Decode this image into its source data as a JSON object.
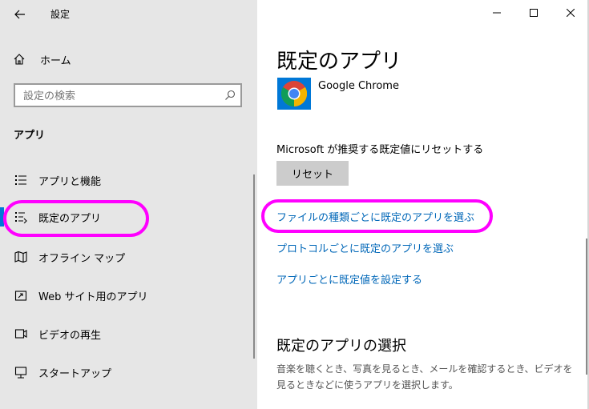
{
  "window": {
    "title": "設定",
    "controls": [
      "minimize",
      "maximize",
      "close"
    ]
  },
  "sidebar": {
    "home_label": "ホーム",
    "search": {
      "placeholder": "設定の検索"
    },
    "section_title": "アプリ",
    "items": [
      {
        "label": "アプリと機能",
        "icon": "list-icon",
        "selected": false
      },
      {
        "label": "既定のアプリ",
        "icon": "default-apps-icon",
        "selected": true
      },
      {
        "label": "オフライン マップ",
        "icon": "map-icon",
        "selected": false
      },
      {
        "label": "Web サイト用のアプリ",
        "icon": "open-window-icon",
        "selected": false
      },
      {
        "label": "ビデオの再生",
        "icon": "video-icon",
        "selected": false
      },
      {
        "label": "スタートアップ",
        "icon": "startup-icon",
        "selected": false
      }
    ]
  },
  "main": {
    "title": "既定のアプリ",
    "current_app": {
      "name": "Google Chrome",
      "icon": "chrome-icon"
    },
    "reset": {
      "description": "Microsoft が推奨する既定値にリセットする",
      "button_label": "リセット"
    },
    "links": [
      "ファイルの種類ごとに既定のアプリを選ぶ",
      "プロトコルごとに既定のアプリを選ぶ",
      "アプリごとに既定値を設定する"
    ],
    "section_title": "既定のアプリの選択",
    "section_description": "音楽を聴くとき、写真を見るとき、メールを確認するとき、ビデオを見るときなどに使うアプリを選択します。"
  },
  "colors": {
    "sidebar_bg": "#e6e6e6",
    "accent": "#0078d7",
    "link": "#0067b8",
    "highlight": "#ff00ff"
  }
}
